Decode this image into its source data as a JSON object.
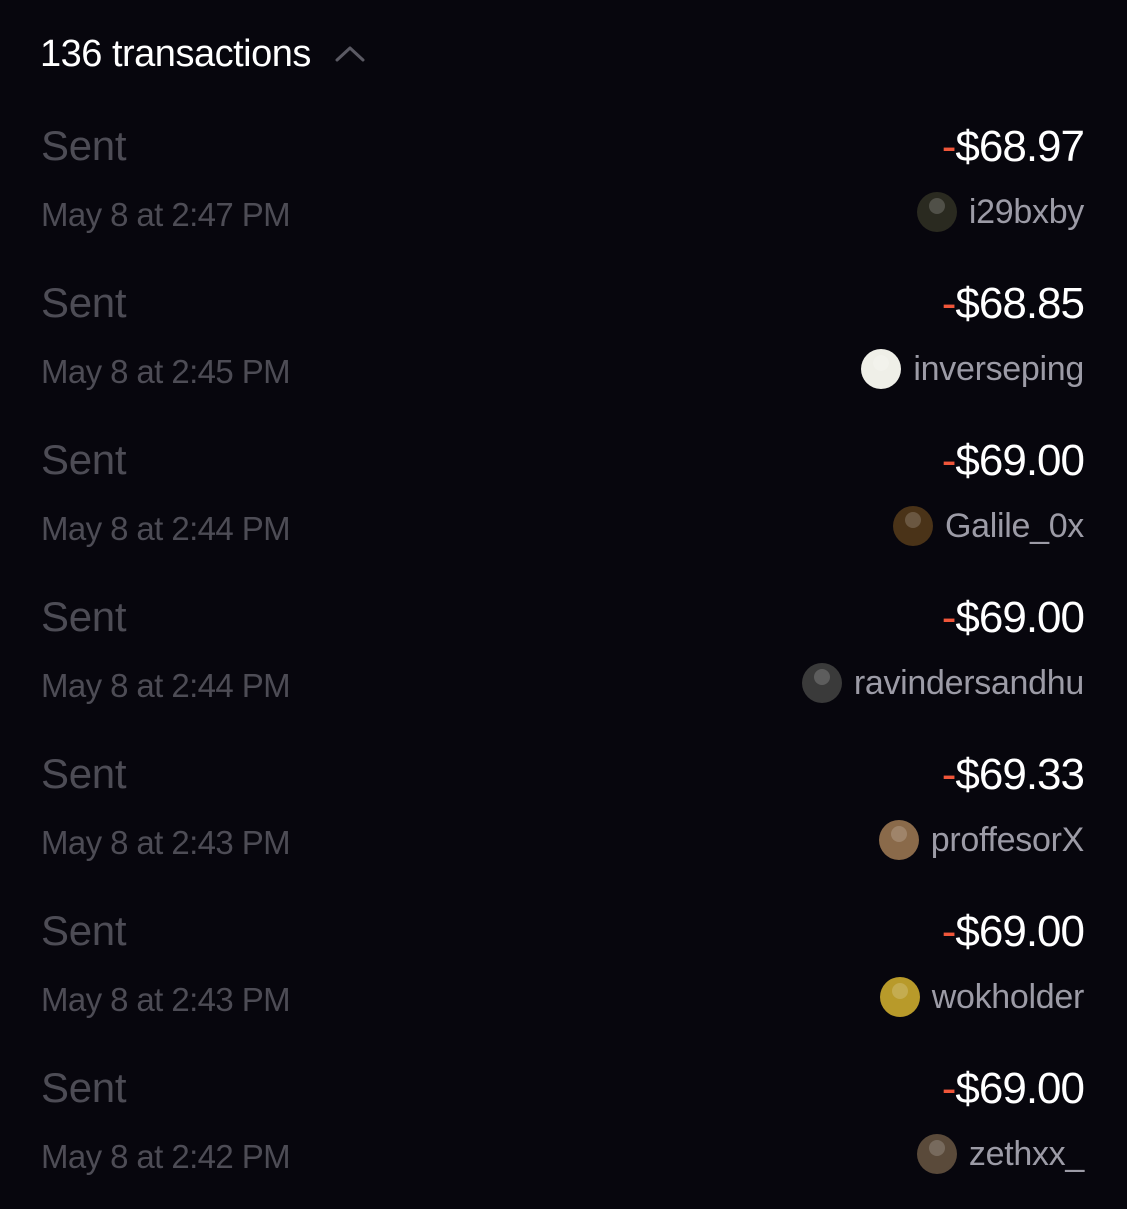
{
  "header": {
    "title": "136 transactions",
    "toggle_icon": "chevron-up-icon"
  },
  "colors": {
    "background": "#07060d",
    "negative_sign": "#f0563a",
    "muted_text": "#4d4c55",
    "username_text": "#9c9ba6"
  },
  "transactions": [
    {
      "type": "Sent",
      "time": "May 8 at 2:47 PM",
      "sign": "-",
      "amount": "$68.97",
      "user": "i29bxby",
      "avatar_color": "#2a2a20"
    },
    {
      "type": "Sent",
      "time": "May 8 at 2:45 PM",
      "sign": "-",
      "amount": "$68.85",
      "user": "inverseping",
      "avatar_color": "#efefe8"
    },
    {
      "type": "Sent",
      "time": "May 8 at 2:44 PM",
      "sign": "-",
      "amount": "$69.00",
      "user": "Galile_0x",
      "avatar_color": "#4a3318"
    },
    {
      "type": "Sent",
      "time": "May 8 at 2:44 PM",
      "sign": "-",
      "amount": "$69.00",
      "user": "ravindersandhu",
      "avatar_color": "#3a3a3a"
    },
    {
      "type": "Sent",
      "time": "May 8 at 2:43 PM",
      "sign": "-",
      "amount": "$69.33",
      "user": "proffesorX",
      "avatar_color": "#8a6a4a"
    },
    {
      "type": "Sent",
      "time": "May 8 at 2:43 PM",
      "sign": "-",
      "amount": "$69.00",
      "user": "wokholder",
      "avatar_color": "#b89a2a"
    },
    {
      "type": "Sent",
      "time": "May 8 at 2:42 PM",
      "sign": "-",
      "amount": "$69.00",
      "user": "zethxx_",
      "avatar_color": "#5a4a3a"
    }
  ]
}
